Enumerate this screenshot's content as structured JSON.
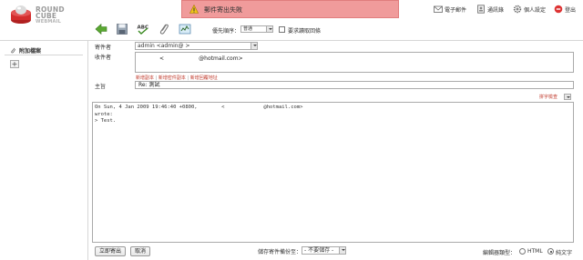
{
  "brand": {
    "line1": "ROUND",
    "line2": "CUBE",
    "line3": "WEBMAIL"
  },
  "alert": {
    "message": "郵件寄出失敗"
  },
  "topnav": {
    "compose": "電子郵件",
    "addressbook": "通訊錄",
    "settings": "個人設定",
    "logout": "登出"
  },
  "toolbar": {
    "priority_label": "優先順序：",
    "priority_value": "普通",
    "receipt_label": "要求讀取回條"
  },
  "sidebar": {
    "attachments_title": "附加檔案",
    "add_label": "+"
  },
  "compose": {
    "from_label": "寄件者",
    "from_value": "admin <admin@                      >",
    "to_label": "收件者",
    "to_value": "<                    @hotmail.com>",
    "add_links": [
      "新增副本",
      "新增密件副本",
      "新增回覆地址"
    ],
    "subject_label": "主旨",
    "subject_value": "Re: 測試",
    "spell_link": "拼字檢查",
    "body": "On Sun, 4 Jan 2009 19:46:40 +0800,        <             @hotmail.com>\nwrote:\n> Test."
  },
  "footer": {
    "send_button": "立即寄出",
    "cancel_button": "取消",
    "save_copy_label": "儲存寄件備份至：",
    "save_copy_value": "- 不要儲存 -",
    "editor_type_label": "編輯器類型：",
    "editor_html": "HTML",
    "editor_plain": "純文字"
  }
}
